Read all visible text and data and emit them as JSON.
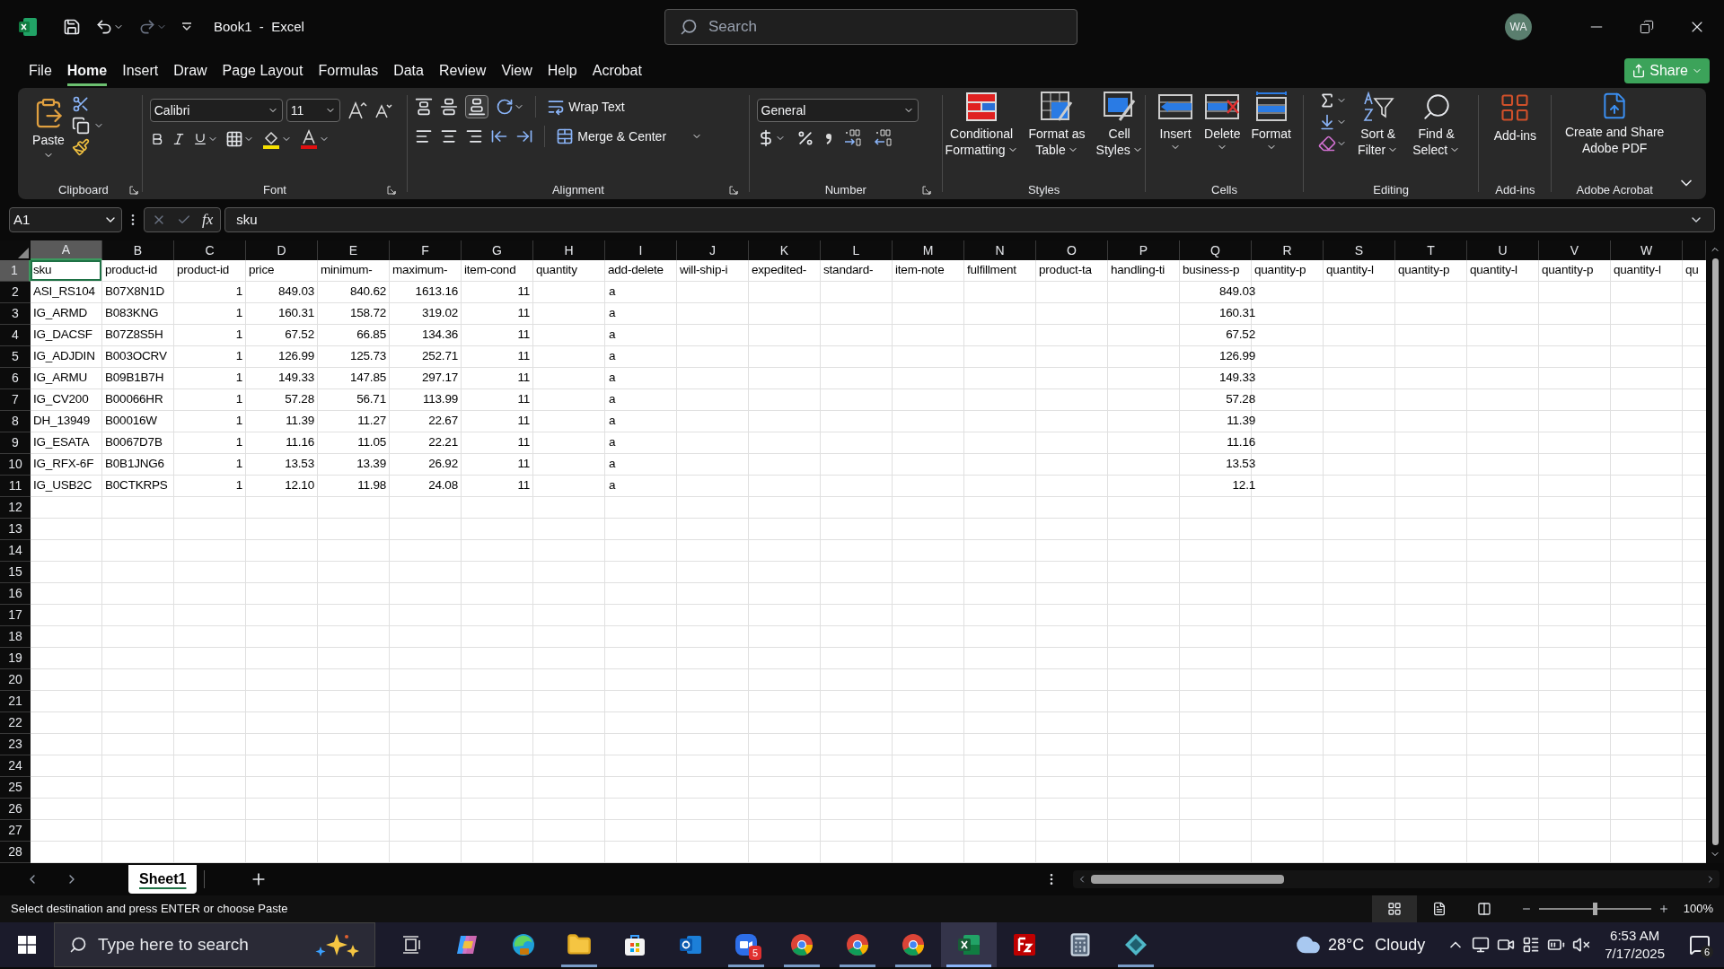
{
  "title_bar": {
    "title": "Book1  -  Excel",
    "search": {
      "placeholder": "Search"
    },
    "account": {
      "initials": "WA"
    }
  },
  "menu_tabs": [
    {
      "label": "File",
      "selected": false
    },
    {
      "label": "Home",
      "selected": true
    },
    {
      "label": "Insert",
      "selected": false
    },
    {
      "label": "Draw",
      "selected": false
    },
    {
      "label": "Page Layout",
      "selected": false
    },
    {
      "label": "Formulas",
      "selected": false
    },
    {
      "label": "Data",
      "selected": false
    },
    {
      "label": "Review",
      "selected": false
    },
    {
      "label": "View",
      "selected": false
    },
    {
      "label": "Help",
      "selected": false
    },
    {
      "label": "Acrobat",
      "selected": false
    }
  ],
  "share_button": {
    "label": "Share"
  },
  "ribbon": {
    "clipboard": {
      "label": "Clipboard",
      "paste": "Paste"
    },
    "font": {
      "label": "Font",
      "font_name": "Calibri",
      "font_size": "11"
    },
    "alignment": {
      "label": "Alignment",
      "wrap_text": "Wrap Text",
      "merge": "Merge & Center"
    },
    "number": {
      "label": "Number",
      "format": "General"
    },
    "styles": {
      "label": "Styles",
      "buttons": [
        {
          "lines": [
            "Conditional",
            "Formatting"
          ]
        },
        {
          "lines": [
            "Format as",
            "Table"
          ]
        },
        {
          "lines": [
            "Cell",
            "Styles"
          ]
        }
      ]
    },
    "cells": {
      "label": "Cells",
      "buttons": [
        {
          "lines": [
            "Insert"
          ]
        },
        {
          "lines": [
            "Delete"
          ]
        },
        {
          "lines": [
            "Format"
          ]
        }
      ]
    },
    "editing": {
      "label": "Editing",
      "buttons": [
        {
          "lines": [
            "Sort &",
            "Filter"
          ]
        },
        {
          "lines": [
            "Find &",
            "Select"
          ]
        }
      ]
    },
    "add_ins": {
      "label": "Add-ins",
      "button": "Add-ins"
    },
    "acrobat": {
      "label": "Adobe Acrobat",
      "lines": [
        "Create and Share",
        "Adobe PDF"
      ]
    }
  },
  "formula_bar": {
    "name_box": "A1",
    "function_label": "fx",
    "value": "sku"
  },
  "sheet": {
    "columns": [
      {
        "letter": "A",
        "selected": true
      },
      {
        "letter": "B",
        "selected": false
      },
      {
        "letter": "C",
        "selected": false
      },
      {
        "letter": "D",
        "selected": false
      },
      {
        "letter": "E",
        "selected": false
      },
      {
        "letter": "F",
        "selected": false
      },
      {
        "letter": "G",
        "selected": false
      },
      {
        "letter": "H",
        "selected": false
      },
      {
        "letter": "I",
        "selected": false
      },
      {
        "letter": "J",
        "selected": false
      },
      {
        "letter": "K",
        "selected": false
      },
      {
        "letter": "L",
        "selected": false
      },
      {
        "letter": "M",
        "selected": false
      },
      {
        "letter": "N",
        "selected": false
      },
      {
        "letter": "O",
        "selected": false
      },
      {
        "letter": "P",
        "selected": false
      },
      {
        "letter": "Q",
        "selected": false
      },
      {
        "letter": "R",
        "selected": false
      },
      {
        "letter": "S",
        "selected": false
      },
      {
        "letter": "T",
        "selected": false
      },
      {
        "letter": "U",
        "selected": false
      },
      {
        "letter": "V",
        "selected": false
      },
      {
        "letter": "W",
        "selected": false
      },
      {
        "selected": false
      }
    ],
    "rows": [
      {
        "number": "1",
        "selected": true,
        "cells": [
          "sku",
          "product-id",
          "product-id",
          "price",
          "minimum-",
          "maximum-",
          "item-cond",
          "quantity",
          "add-delete",
          "will-ship-i",
          "expedited-",
          "standard-",
          "item-note",
          "fulfillment",
          "product-ta",
          "handling-ti",
          "business-p",
          "quantity-p",
          "quantity-l",
          "quantity-p",
          "quantity-l",
          "quantity-p",
          "quantity-l",
          "qu"
        ]
      },
      {
        "number": "2",
        "selected": false,
        "cells": [
          "ASI_RS104",
          "B07X8N1D",
          "1",
          "849.03",
          "840.62",
          "1613.16",
          "11",
          null,
          "a",
          null,
          null,
          null,
          null,
          null,
          null,
          null,
          "849.03"
        ]
      },
      {
        "number": "3",
        "selected": false,
        "cells": [
          "IG_ARMD",
          "B083KNG",
          "1",
          "160.31",
          "158.72",
          "319.02",
          "11",
          null,
          "a",
          null,
          null,
          null,
          null,
          null,
          null,
          null,
          "160.31"
        ]
      },
      {
        "number": "4",
        "selected": false,
        "cells": [
          "IG_DACSF",
          "B07Z8S5H",
          "1",
          "67.52",
          "66.85",
          "134.36",
          "11",
          null,
          "a",
          null,
          null,
          null,
          null,
          null,
          null,
          null,
          "67.52"
        ]
      },
      {
        "number": "5",
        "selected": false,
        "cells": [
          "IG_ADJDIN",
          "B003OCRV",
          "1",
          "126.99",
          "125.73",
          "252.71",
          "11",
          null,
          "a",
          null,
          null,
          null,
          null,
          null,
          null,
          null,
          "126.99"
        ]
      },
      {
        "number": "6",
        "selected": false,
        "cells": [
          "IG_ARMU",
          "B09B1B7H",
          "1",
          "149.33",
          "147.85",
          "297.17",
          "11",
          null,
          "a",
          null,
          null,
          null,
          null,
          null,
          null,
          null,
          "149.33"
        ]
      },
      {
        "number": "7",
        "selected": false,
        "cells": [
          "IG_CV200",
          "B00066HR",
          "1",
          "57.28",
          "56.71",
          "113.99",
          "11",
          null,
          "a",
          null,
          null,
          null,
          null,
          null,
          null,
          null,
          "57.28"
        ]
      },
      {
        "number": "8",
        "selected": false,
        "cells": [
          "DH_13949",
          "B00016W",
          "1",
          "11.39",
          "11.27",
          "22.67",
          "11",
          null,
          "a",
          null,
          null,
          null,
          null,
          null,
          null,
          null,
          "11.39"
        ]
      },
      {
        "number": "9",
        "selected": false,
        "cells": [
          "IG_ESATA",
          "B0067D7B",
          "1",
          "11.16",
          "11.05",
          "22.21",
          "11",
          null,
          "a",
          null,
          null,
          null,
          null,
          null,
          null,
          null,
          "11.16"
        ]
      },
      {
        "number": "10",
        "selected": false,
        "cells": [
          "IG_RFX-6F",
          "B0B1JNG6",
          "1",
          "13.53",
          "13.39",
          "26.92",
          "11",
          null,
          "a",
          null,
          null,
          null,
          null,
          null,
          null,
          null,
          "13.53"
        ]
      },
      {
        "number": "11",
        "selected": false,
        "cells": [
          "IG_USB2C",
          "B0CTKRPS",
          "1",
          "12.10",
          "11.98",
          "24.08",
          "11",
          null,
          "a",
          null,
          null,
          null,
          null,
          null,
          null,
          null,
          "12.1"
        ]
      },
      {
        "number": "12",
        "selected": false
      },
      {
        "number": "13",
        "selected": false
      },
      {
        "number": "14",
        "selected": false
      },
      {
        "number": "15",
        "selected": false
      },
      {
        "number": "16",
        "selected": false
      },
      {
        "number": "17",
        "selected": false
      },
      {
        "number": "18",
        "selected": false
      },
      {
        "number": "19",
        "selected": false
      },
      {
        "number": "20",
        "selected": false
      },
      {
        "number": "21",
        "selected": false
      },
      {
        "number": "22",
        "selected": false
      },
      {
        "number": "23",
        "selected": false
      },
      {
        "number": "24",
        "selected": false
      },
      {
        "number": "25",
        "selected": false
      },
      {
        "number": "26",
        "selected": false
      },
      {
        "number": "27",
        "selected": false
      },
      {
        "number": "28",
        "selected": false
      }
    ]
  },
  "sheet_tabs": [
    {
      "label": "Sheet1",
      "selected": true
    }
  ],
  "status_bar": {
    "message": "Select destination and press ENTER or choose Paste",
    "views": [
      {
        "kind": "normal",
        "selected": true
      },
      {
        "kind": "page-layout",
        "selected": false
      },
      {
        "kind": "page-break",
        "selected": false
      }
    ],
    "zoom": {
      "level": 0.5,
      "reading": "100%"
    }
  },
  "taskbar": {
    "search": {
      "placeholder": "Type here to search"
    },
    "apps": [
      {
        "kind": "task-view",
        "running": false,
        "selected": false
      },
      {
        "kind": "copilot",
        "running": false,
        "selected": false
      },
      {
        "kind": "edge",
        "running": false,
        "selected": false
      },
      {
        "kind": "explorer",
        "running": true,
        "selected": false
      },
      {
        "kind": "store",
        "running": false,
        "selected": false
      },
      {
        "kind": "outlook",
        "running": false,
        "selected": false
      },
      {
        "kind": "zoom",
        "running": true,
        "selected": false,
        "badge": "5"
      },
      {
        "kind": "chrome",
        "running": true,
        "selected": false
      },
      {
        "kind": "chrome",
        "running": true,
        "selected": false
      },
      {
        "kind": "chrome",
        "running": true,
        "selected": false
      },
      {
        "kind": "excel",
        "running": true,
        "selected": true
      },
      {
        "kind": "filezilla",
        "running": false,
        "selected": false
      },
      {
        "kind": "calculator",
        "running": false,
        "selected": false
      },
      {
        "kind": "diamond",
        "running": true,
        "selected": false
      }
    ],
    "weather": {
      "temperature": "28°C",
      "condition": "Cloudy"
    },
    "clock": {
      "time": "6:53 AM",
      "date": "7/17/2025"
    },
    "notifications": {
      "count": "6"
    }
  }
}
